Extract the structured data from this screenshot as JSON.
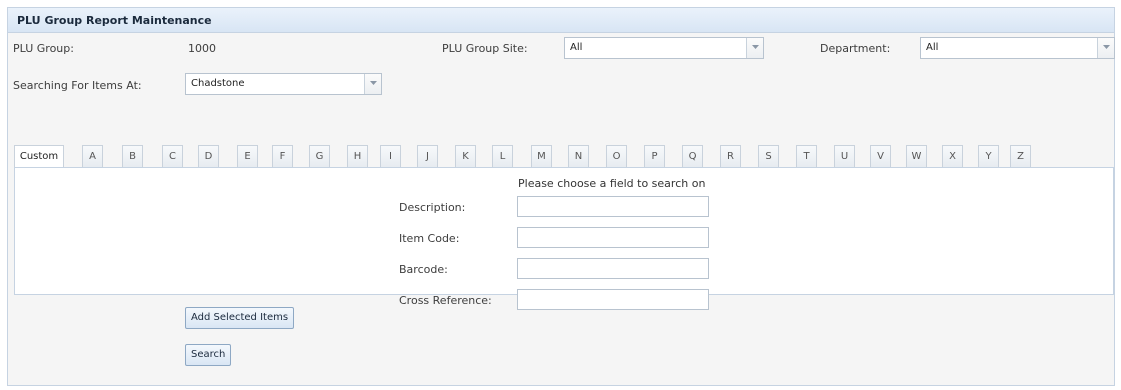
{
  "panel": {
    "title": "PLU Group Report Maintenance"
  },
  "form": {
    "plu_group_label": "PLU Group:",
    "plu_group_value": "1000",
    "plu_group_site_label": "PLU Group Site:",
    "plu_group_site_value": "All",
    "department_label": "Department:",
    "department_value": "All",
    "searching_label": "Searching For Items At:",
    "searching_value": "Chadstone"
  },
  "tabs": [
    "Custom",
    "A",
    "B",
    "C",
    "D",
    "E",
    "F",
    "G",
    "H",
    "I",
    "J",
    "K",
    "L",
    "M",
    "N",
    "O",
    "P",
    "Q",
    "R",
    "S",
    "T",
    "U",
    "V",
    "W",
    "X",
    "Y",
    "Z"
  ],
  "active_tab": "Custom",
  "search": {
    "prompt": "Please choose a field to search on",
    "fields": [
      {
        "label": "Description:",
        "value": ""
      },
      {
        "label": "Item Code:",
        "value": ""
      },
      {
        "label": "Barcode:",
        "value": ""
      },
      {
        "label": "Cross Reference:",
        "value": ""
      }
    ]
  },
  "buttons": {
    "add_selected": "Add Selected Items",
    "search": "Search"
  },
  "icons": {
    "combo_trigger": "chevron-down-icon"
  }
}
